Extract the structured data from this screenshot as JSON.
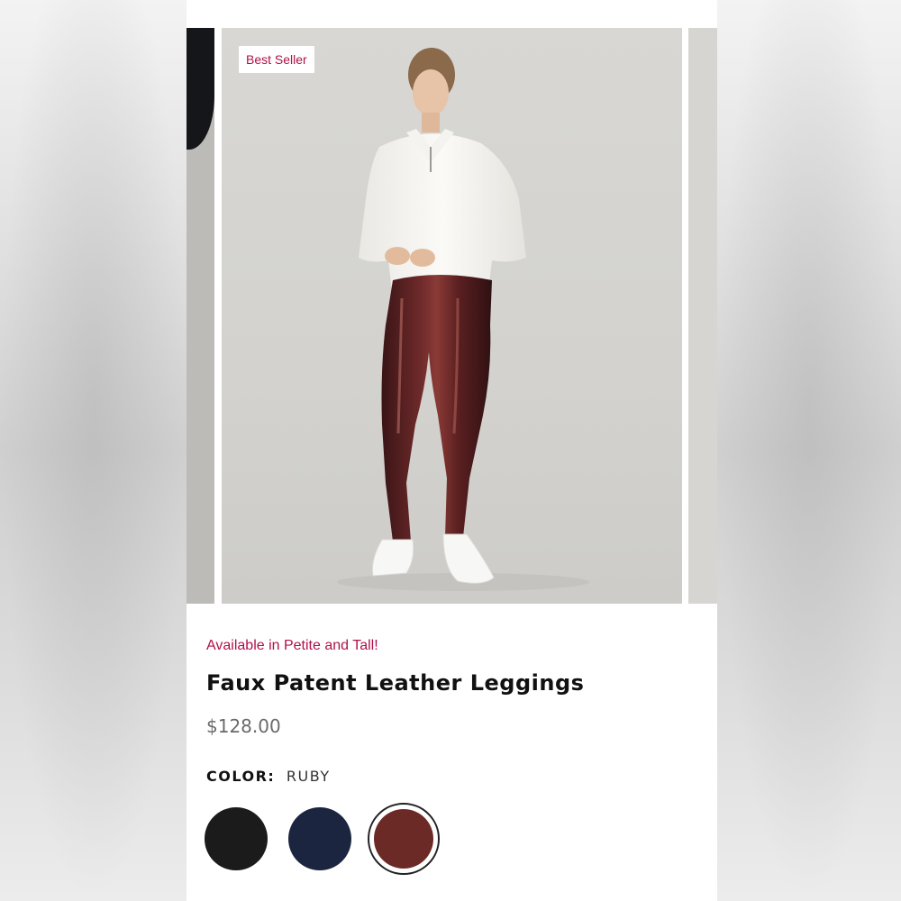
{
  "badge": "Best Seller",
  "availability": "Available in Petite and Tall!",
  "product": {
    "title": "Faux Patent Leather Leggings",
    "price": "$128.00"
  },
  "color": {
    "label": "COLOR:",
    "selected": "RUBY",
    "swatches": [
      {
        "name": "black",
        "hex": "#1b1b1b"
      },
      {
        "name": "navy",
        "hex": "#1c2540"
      },
      {
        "name": "ruby",
        "hex": "#6b2a26"
      }
    ]
  },
  "colors": {
    "accent": "#b0114a"
  }
}
